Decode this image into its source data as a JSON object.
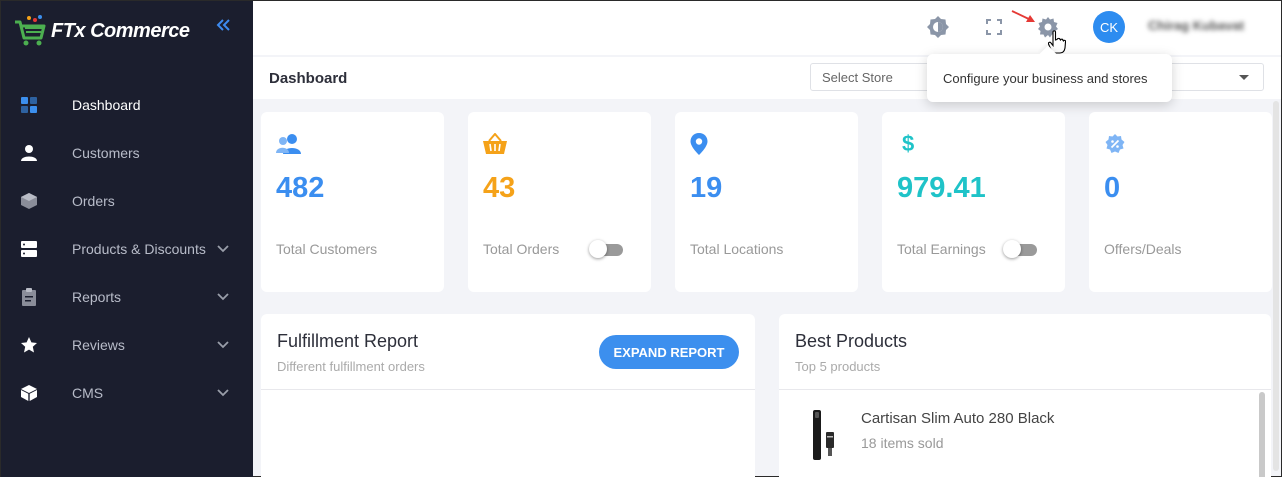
{
  "brand": {
    "name": "FTx Commerce"
  },
  "sidebar": {
    "items": [
      {
        "label": "Dashboard",
        "icon": "dashboard-icon",
        "active": true
      },
      {
        "label": "Customers",
        "icon": "user-icon"
      },
      {
        "label": "Orders",
        "icon": "box-icon"
      },
      {
        "label": "Products & Discounts",
        "icon": "server-icon",
        "expandable": true
      },
      {
        "label": "Reports",
        "icon": "clipboard-icon",
        "expandable": true
      },
      {
        "label": "Reviews",
        "icon": "star-icon",
        "expandable": true
      },
      {
        "label": "CMS",
        "icon": "cube-icon",
        "expandable": true
      }
    ]
  },
  "topbar": {
    "avatar_initials": "CK",
    "username": "Chirag Kubavat"
  },
  "header": {
    "title": "Dashboard",
    "store_select_placeholder": "Select Store"
  },
  "tooltip": {
    "text": "Configure your business and stores"
  },
  "stats": [
    {
      "value": "482",
      "label": "Total Customers",
      "color": "#3b8ef0",
      "icon": "users-icon"
    },
    {
      "value": "43",
      "label": "Total Orders",
      "color": "#f5a219",
      "icon": "basket-icon",
      "toggle": true
    },
    {
      "value": "19",
      "label": "Total Locations",
      "color": "#3b8ef0",
      "icon": "location-pin-icon"
    },
    {
      "value": "979.41",
      "label": "Total Earnings",
      "color": "#1fc3c8",
      "icon": "dollar-icon",
      "toggle": true
    },
    {
      "value": "0",
      "label": "Offers/Deals",
      "color": "#3b8ef0",
      "icon": "offer-badge-icon"
    }
  ],
  "fulfillment": {
    "title": "Fulfillment Report",
    "subtitle": "Different fulfillment orders",
    "button": "EXPAND REPORT"
  },
  "best_products": {
    "title": "Best Products",
    "subtitle": "Top 5 products",
    "items": [
      {
        "name": "Cartisan Slim Auto 280 Black",
        "sold": "18 items sold"
      }
    ]
  },
  "colors": {
    "accent": "#3c8fee",
    "sidebar_bg": "#1b1e2e",
    "teal": "#1fc3c8",
    "orange": "#f5a219"
  }
}
